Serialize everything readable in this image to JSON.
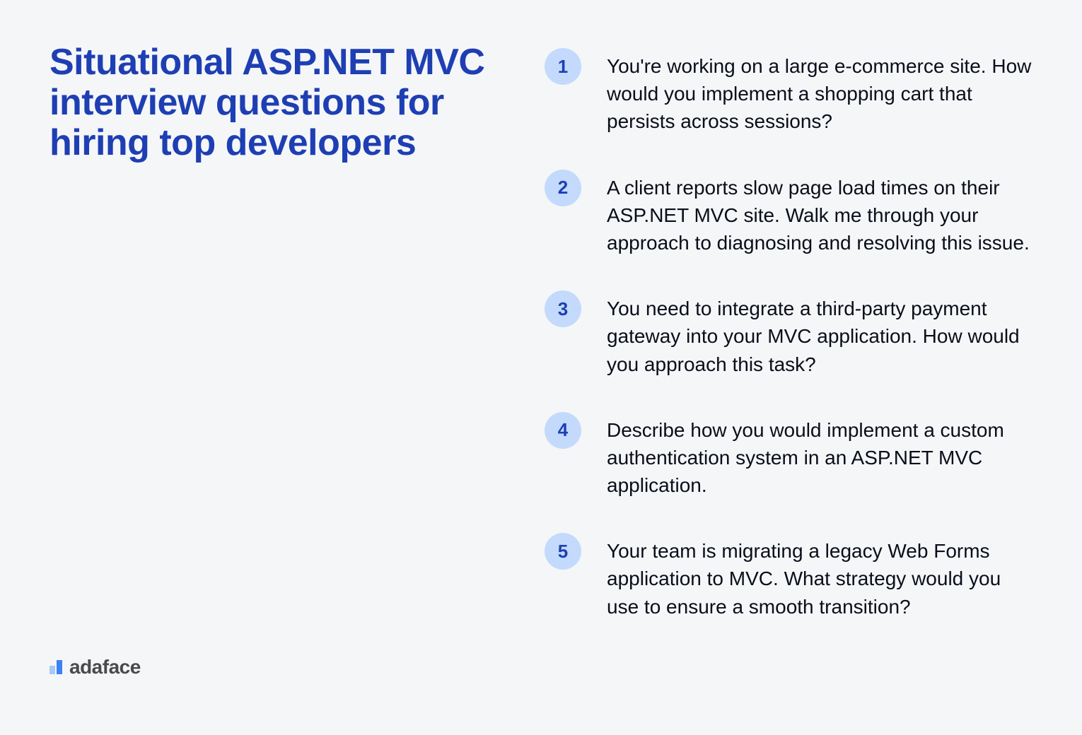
{
  "title": "Situational ASP.NET MVC interview questions for hiring top developers",
  "brand": "adaface",
  "questions": [
    {
      "number": "1",
      "text": "You're working on a large e-commerce site. How would you implement a shopping cart that persists across sessions?"
    },
    {
      "number": "2",
      "text": "A client reports slow page load times on their ASP.NET MVC site. Walk me through your approach to diagnosing and resolving this issue."
    },
    {
      "number": "3",
      "text": "You need to integrate a third-party payment gateway into your MVC application. How would you approach this task?"
    },
    {
      "number": "4",
      "text": "Describe how you would implement a custom authentication system in an ASP.NET MVC application."
    },
    {
      "number": "5",
      "text": "Your team is migrating a legacy Web Forms application to MVC. What strategy would you use to ensure a smooth transition?"
    }
  ]
}
